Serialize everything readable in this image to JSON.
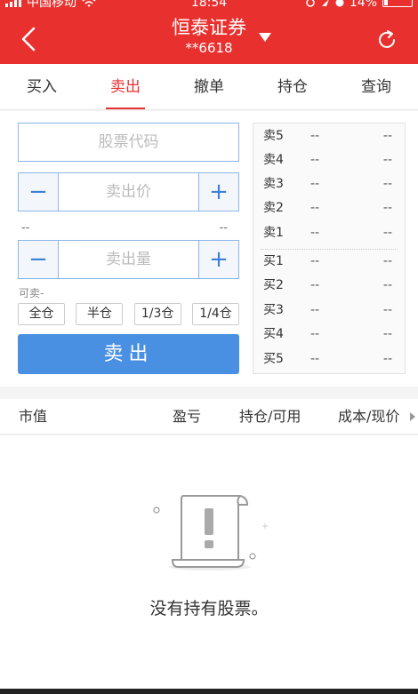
{
  "status_bar": {
    "carrier": "中国移动",
    "time": "18:54",
    "battery": "14%"
  },
  "header": {
    "title": "恒泰证券",
    "account": "**6618"
  },
  "tabs": [
    "买入",
    "卖出",
    "撤单",
    "持仓",
    "查询"
  ],
  "active_tab": 1,
  "form": {
    "code_placeholder": "股票代码",
    "price_placeholder": "卖出价",
    "qty_placeholder": "卖出量",
    "minus_label": "−",
    "plus_label": "+",
    "range_low": "--",
    "range_high": "--",
    "available_label": "可卖-",
    "position_buttons": [
      "全仓",
      "半仓",
      "1/3仓",
      "1/4仓"
    ],
    "sell_button": "卖出"
  },
  "order_book": {
    "asks": [
      {
        "label": "卖5",
        "price": "--",
        "volume": "--"
      },
      {
        "label": "卖4",
        "price": "--",
        "volume": "--"
      },
      {
        "label": "卖3",
        "price": "--",
        "volume": "--"
      },
      {
        "label": "卖2",
        "price": "--",
        "volume": "--"
      },
      {
        "label": "卖1",
        "price": "--",
        "volume": "--"
      }
    ],
    "bids": [
      {
        "label": "买1",
        "price": "--",
        "volume": "--"
      },
      {
        "label": "买2",
        "price": "--",
        "volume": "--"
      },
      {
        "label": "买3",
        "price": "--",
        "volume": "--"
      },
      {
        "label": "买4",
        "price": "--",
        "volume": "--"
      },
      {
        "label": "买5",
        "price": "--",
        "volume": "--"
      }
    ]
  },
  "holdings": {
    "columns": [
      "市值",
      "盈亏",
      "持仓/可用",
      "成本/现价"
    ],
    "empty_text": "没有持有股票。"
  },
  "colors": {
    "brand": "#e8312f",
    "accent": "#4a90e2"
  }
}
